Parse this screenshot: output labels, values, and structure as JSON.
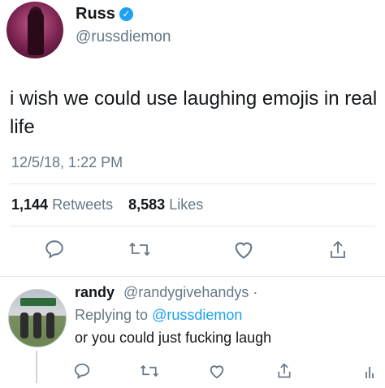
{
  "tweet": {
    "author_name": "Russ",
    "author_handle": "@russdiemon",
    "verified_icon": "verified-badge-icon",
    "text": "i wish we could use laughing emojis in real life",
    "timestamp": "12/5/18, 1:22 PM",
    "retweets_count": "1,144",
    "retweets_label": "Retweets",
    "likes_count": "8,583",
    "likes_label": "Likes",
    "actions": [
      "reply-icon",
      "retweet-icon",
      "like-icon",
      "share-icon"
    ]
  },
  "reply": {
    "author_name": "randy",
    "author_handle": "@randygivehandys ·",
    "replying_prefix": "Replying to",
    "replying_to": "@russdiemon",
    "text": "or you could just fucking laugh",
    "actions": [
      "reply-icon",
      "retweet-icon",
      "like-icon",
      "share-icon",
      "analytics-icon"
    ]
  },
  "colors": {
    "text": "#14171a",
    "secondary": "#657786",
    "link": "#1da1f2",
    "divider": "#e1e8ed"
  }
}
